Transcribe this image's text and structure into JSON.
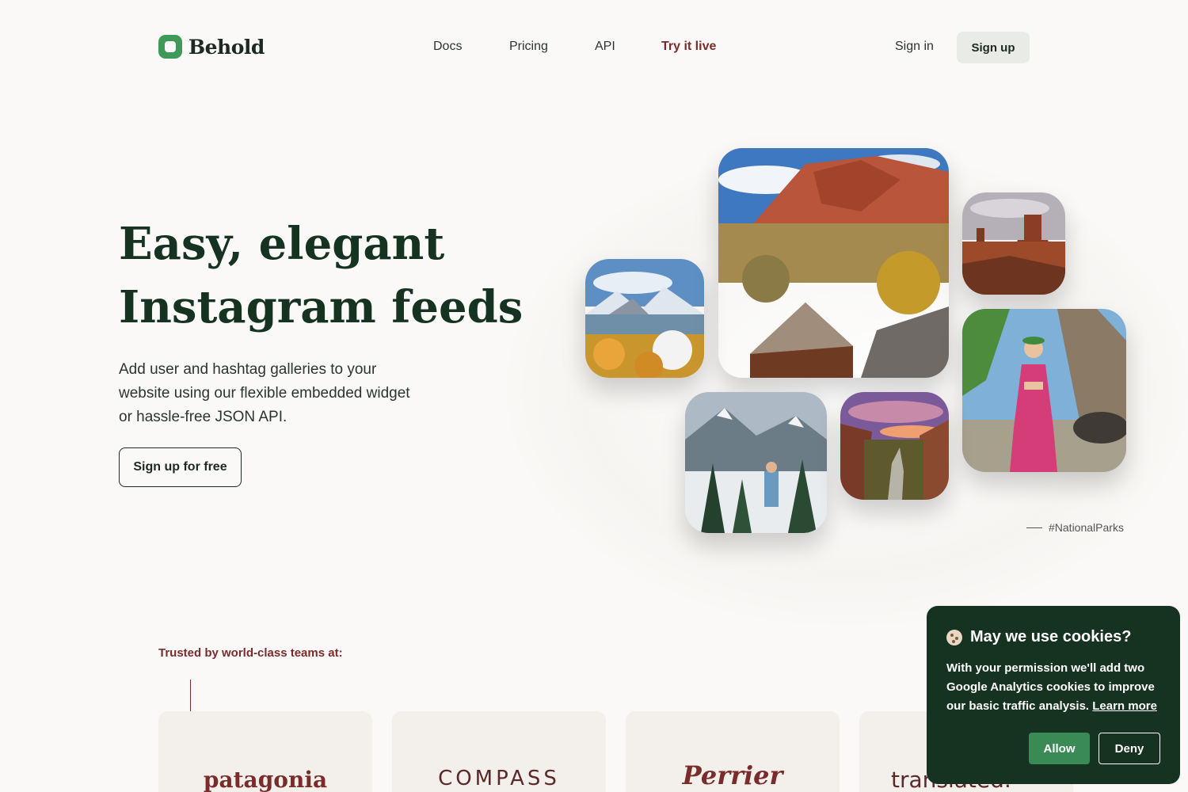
{
  "header": {
    "logo_text": "Behold",
    "nav": [
      {
        "label": "Docs"
      },
      {
        "label": "Pricing"
      },
      {
        "label": "API"
      },
      {
        "label": "Try it live"
      }
    ],
    "signin_label": "Sign in",
    "signup_label": "Sign up"
  },
  "hero": {
    "title_line1": "Easy, elegant",
    "title_line2": "Instagram feeds",
    "subtitle": "Add user and hashtag galleries to your website using our flexible embedded widget or hassle-free JSON API.",
    "cta_label": "Sign up for free"
  },
  "gallery": {
    "hashtag": "#NationalParks",
    "tiles": [
      {
        "name": "snowy-lake-photo"
      },
      {
        "name": "red-cliff-barn-photo"
      },
      {
        "name": "desert-butte-photo"
      },
      {
        "name": "mountain-hiker-photo"
      },
      {
        "name": "canyon-river-photo"
      },
      {
        "name": "palm-dress-photo"
      }
    ]
  },
  "trusted": {
    "label": "Trusted by world-class teams at:",
    "brands": [
      "patagonia",
      "COMPASS",
      "Perrier",
      "translated."
    ]
  },
  "cookie": {
    "title": "May we use cookies?",
    "body": "With your permission we'll add two Google Analytics cookies to improve our basic traffic analysis.",
    "learn_more": "Learn more",
    "allow_label": "Allow",
    "deny_label": "Deny"
  },
  "colors": {
    "brand_green": "#3f9a5a",
    "dark_green": "#163321",
    "accent_maroon": "#7a2b2b",
    "background": "#faf9f7"
  }
}
